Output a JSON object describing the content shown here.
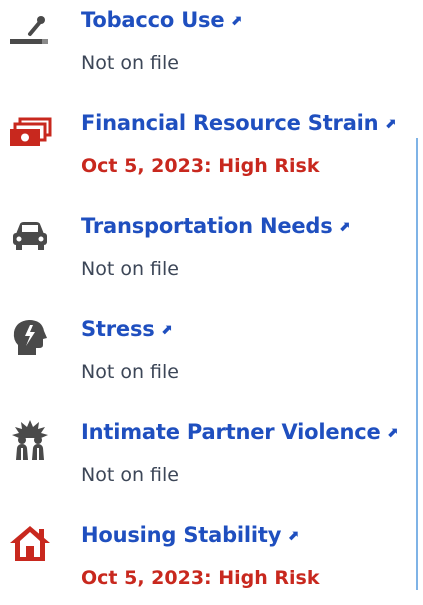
{
  "colors": {
    "link": "#1f4fbf",
    "risk": "#c8281e",
    "muted": "#3c4657",
    "icon_dark": "#4a4a4a",
    "icon_red": "#c8281e"
  },
  "items": [
    {
      "title": "Tobacco Use",
      "status": "Not on file",
      "icon": "cigarette-icon",
      "risk": false
    },
    {
      "title": "Financial Resource Strain",
      "status": "Oct 5, 2023: High Risk",
      "icon": "money-icon",
      "risk": true
    },
    {
      "title": "Transportation Needs",
      "status": "Not on file",
      "icon": "car-icon",
      "risk": false
    },
    {
      "title": "Stress",
      "status": "Not on file",
      "icon": "stress-head-icon",
      "risk": false
    },
    {
      "title": "Intimate Partner Violence",
      "status": "Not on file",
      "icon": "violence-icon",
      "risk": false
    },
    {
      "title": "Housing Stability",
      "status": "Oct 5, 2023: High Risk",
      "icon": "house-icon",
      "risk": true
    }
  ]
}
